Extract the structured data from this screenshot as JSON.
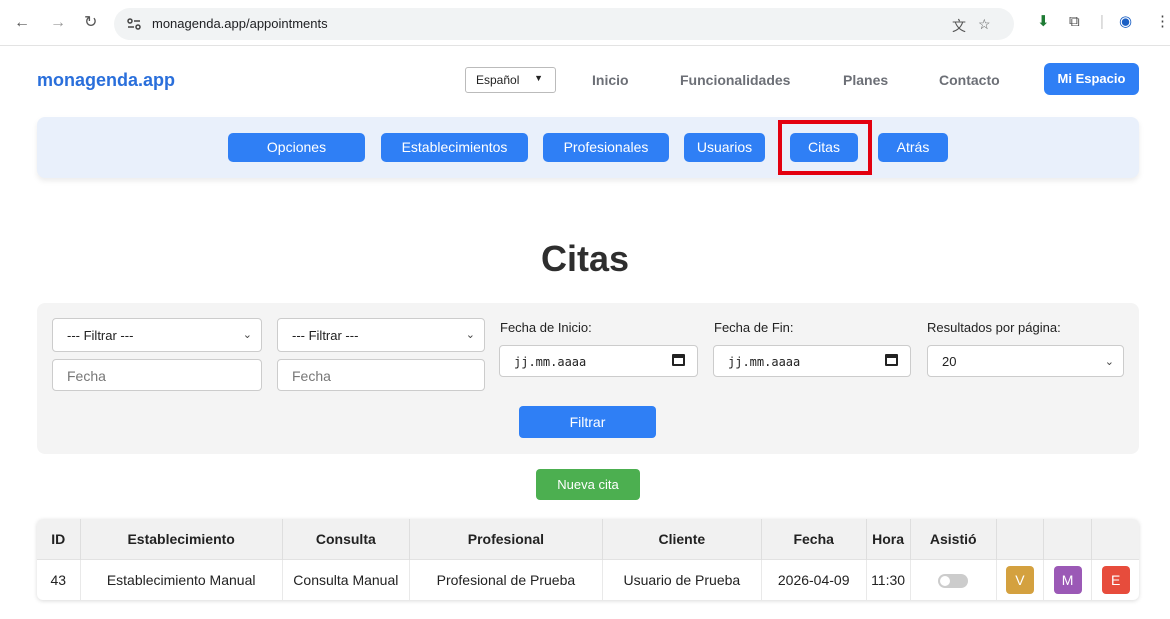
{
  "browser": {
    "url": "monagenda.app/appointments"
  },
  "header": {
    "brand": "monagenda.app",
    "language": "Español",
    "nav": [
      "Inicio",
      "Funcionalidades",
      "Planes",
      "Contacto"
    ],
    "cta": "Mi Espacio"
  },
  "admin_tabs": [
    "Opciones",
    "Establecimientos",
    "Profesionales",
    "Usuarios",
    "Citas",
    "Atrás"
  ],
  "page_title": "Citas",
  "filters": {
    "filter1": "--- Filtrar ---",
    "filter2": "--- Filtrar ---",
    "text1_placeholder": "Fecha",
    "text2_placeholder": "Fecha",
    "start_label": "Fecha de Inicio:",
    "end_label": "Fecha de Fin:",
    "date_placeholder": "jj.mm.aaaa",
    "per_page_label": "Resultados por página:",
    "per_page_value": "20",
    "submit": "Filtrar"
  },
  "new_button": "Nueva cita",
  "table": {
    "headers": [
      "ID",
      "Establecimiento",
      "Consulta",
      "Profesional",
      "Cliente",
      "Fecha",
      "Hora",
      "Asistió"
    ],
    "rows": [
      {
        "id": "43",
        "establecimiento": "Establecimiento Manual",
        "consulta": "Consulta Manual",
        "profesional": "Profesional de Prueba",
        "cliente": "Usuario de Prueba",
        "fecha": "2026-04-09",
        "hora": "11:30",
        "asistio": false,
        "actions": [
          "V",
          "M",
          "E"
        ]
      }
    ]
  },
  "colors": {
    "primary": "#2f7ff5",
    "success": "#4caf50",
    "action_v": "#d4a13f",
    "action_m": "#9b59b6",
    "action_e": "#e74c3c",
    "highlight": "#e3000f"
  }
}
